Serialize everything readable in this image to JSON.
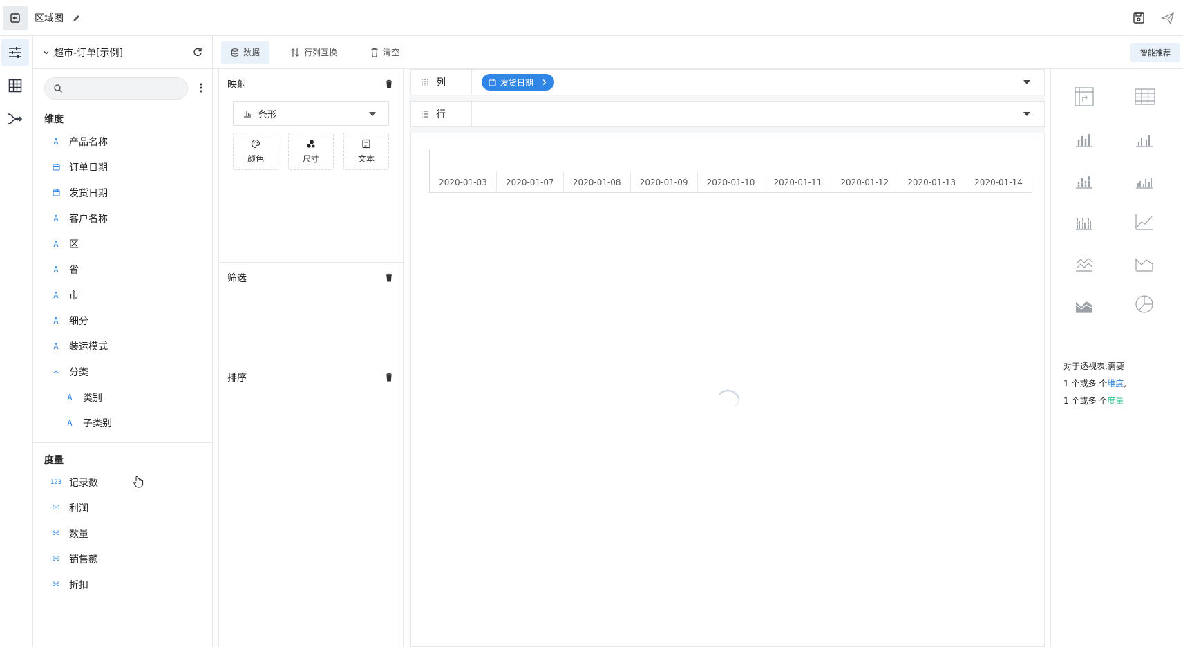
{
  "header": {
    "title": "区域图",
    "back_icon": "exit-icon",
    "edit_icon": "pencil-icon",
    "save_icon": "save-icon",
    "share_icon": "send-icon"
  },
  "rail": {
    "items": [
      {
        "icon": "sliders-icon",
        "active": true
      },
      {
        "icon": "grid-icon",
        "active": false
      },
      {
        "icon": "flow-icon",
        "active": false
      }
    ]
  },
  "dataset": {
    "name": "超市-订单[示例]",
    "search_placeholder": "",
    "dimensions_title": "维度",
    "dimensions": [
      {
        "type": "A",
        "label": "产品名称"
      },
      {
        "type": "date",
        "label": "订单日期"
      },
      {
        "type": "date",
        "label": "发货日期"
      },
      {
        "type": "A",
        "label": "客户名称"
      },
      {
        "type": "A",
        "label": "区"
      },
      {
        "type": "A",
        "label": "省"
      },
      {
        "type": "A",
        "label": "市"
      },
      {
        "type": "A",
        "label": "细分"
      },
      {
        "type": "A",
        "label": "装运模式"
      }
    ],
    "hierarchy": {
      "label": "分类",
      "children": [
        "类别",
        "子类别"
      ]
    },
    "hierarchy_types": [
      "A",
      "A"
    ],
    "type_A": "A",
    "measures_title": "度量",
    "measures": [
      {
        "type": "123",
        "label": "记录数"
      },
      {
        "type": "00",
        "label": "利润"
      },
      {
        "type": "00",
        "label": "数量"
      },
      {
        "type": "00",
        "label": "销售额"
      },
      {
        "type": "00",
        "label": "折扣"
      }
    ]
  },
  "toolbar": {
    "data_label": "数据",
    "swap_label": "行列互换",
    "clear_label": "清空",
    "smart_label": "智能推荐"
  },
  "config": {
    "mapping_title": "映射",
    "chart_type": "条形",
    "encodings": [
      "颜色",
      "尺寸",
      "文本"
    ],
    "filter_title": "筛选",
    "sort_title": "排序"
  },
  "shelves": {
    "columns_label": "列",
    "rows_label": "行",
    "column_pill": "发货日期"
  },
  "chart_data": {
    "type": "bar",
    "categories": [
      "2020-01-03",
      "2020-01-07",
      "2020-01-08",
      "2020-01-09",
      "2020-01-10",
      "2020-01-11",
      "2020-01-12",
      "2020-01-13",
      "2020-01-14"
    ],
    "values": [],
    "title": "",
    "xlabel": "",
    "ylabel": "",
    "grid": false,
    "loading": true
  },
  "hint": {
    "line1": "对于透视表,需要",
    "line2_prefix": "1 个或多 个",
    "line2_dim": "维度",
    "line2_suffix": ",",
    "line3_prefix": "1 个或多 个",
    "line3_mea": "度量"
  },
  "chart_types": [
    "pivot-table-icon",
    "table-icon",
    "bar-icon",
    "grouped-bar-icon",
    "stacked-bar-icon",
    "percent-bar-icon",
    "multi-bar-icon",
    "line-icon",
    "multi-line-icon",
    "area-icon",
    "stacked-area-icon",
    "pie-icon"
  ],
  "colors": {
    "accent": "#2f86e6",
    "measure": "#2cc28e",
    "border": "#e8e8e8"
  }
}
